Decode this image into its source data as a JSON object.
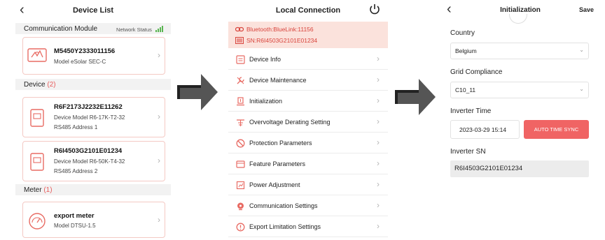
{
  "colors": {
    "accent": "#e85d5d",
    "card_border": "#f4c9c4",
    "section_bg": "#f2f2f2",
    "bt_bg": "#fbe2dc",
    "sync_button": "#f06464",
    "signal": "#5ab552",
    "arrow": "#555555"
  },
  "device_list": {
    "back_icon": "chevron-left-icon",
    "title": "Device List",
    "comm_section_label": "Communication Module",
    "network_status_label": "Network Status",
    "comm_module": {
      "name": "M5450Y2333011156",
      "model": "Model  eSolar SEC-C",
      "icon": "datalogger-icon"
    },
    "device_section_label": "Device",
    "device_count": "(2)",
    "devices": [
      {
        "name": "R6F2173J2232E11262",
        "model": "Device Model  R6-17K-T2-32",
        "address": "RS485 Address  1",
        "icon": "inverter-icon"
      },
      {
        "name": "R6I4503G2101E01234",
        "model": "Device Model  R6-50K-T4-32",
        "address": "RS485 Address  2",
        "icon": "inverter-icon"
      }
    ],
    "meter_section_label": "Meter",
    "meter_count": "(1)",
    "meter": {
      "name": "export meter",
      "model": "Model  DTSU-1.5",
      "icon": "meter-gauge-icon"
    }
  },
  "local_connection": {
    "title": "Local Connection",
    "power_icon": "power-icon",
    "bluetooth_line": "Bluetooth:BlueLink:11156",
    "sn_line": "SN:R6I4503G2101E01234",
    "menu": [
      {
        "label": "Device Info",
        "icon": "device-info-icon"
      },
      {
        "label": "Device Maintenance",
        "icon": "maintenance-icon"
      },
      {
        "label": "Initialization",
        "icon": "initialization-icon"
      },
      {
        "label": "Overvoltage Derating Setting",
        "icon": "overvoltage-icon"
      },
      {
        "label": "Protection Parameters",
        "icon": "protection-icon"
      },
      {
        "label": "Feature Parameters",
        "icon": "feature-icon"
      },
      {
        "label": "Power Adjustment",
        "icon": "power-adjust-icon"
      },
      {
        "label": "Communication Settings",
        "icon": "communication-icon"
      },
      {
        "label": "Export Limitation Settings",
        "icon": "export-limit-icon"
      }
    ]
  },
  "initialization": {
    "back_icon": "chevron-left-icon",
    "title": "Initialization",
    "save_label": "Save",
    "country_label": "Country",
    "country_value": "Belgium",
    "grid_label": "Grid Compliance",
    "grid_value": "C10_11",
    "time_label": "Inverter Time",
    "time_value": "2023-03-29 15:14",
    "sync_label": "AUTO TIME SYNC",
    "sn_label": "Inverter SN",
    "sn_value": "R6I4503G2101E01234"
  }
}
